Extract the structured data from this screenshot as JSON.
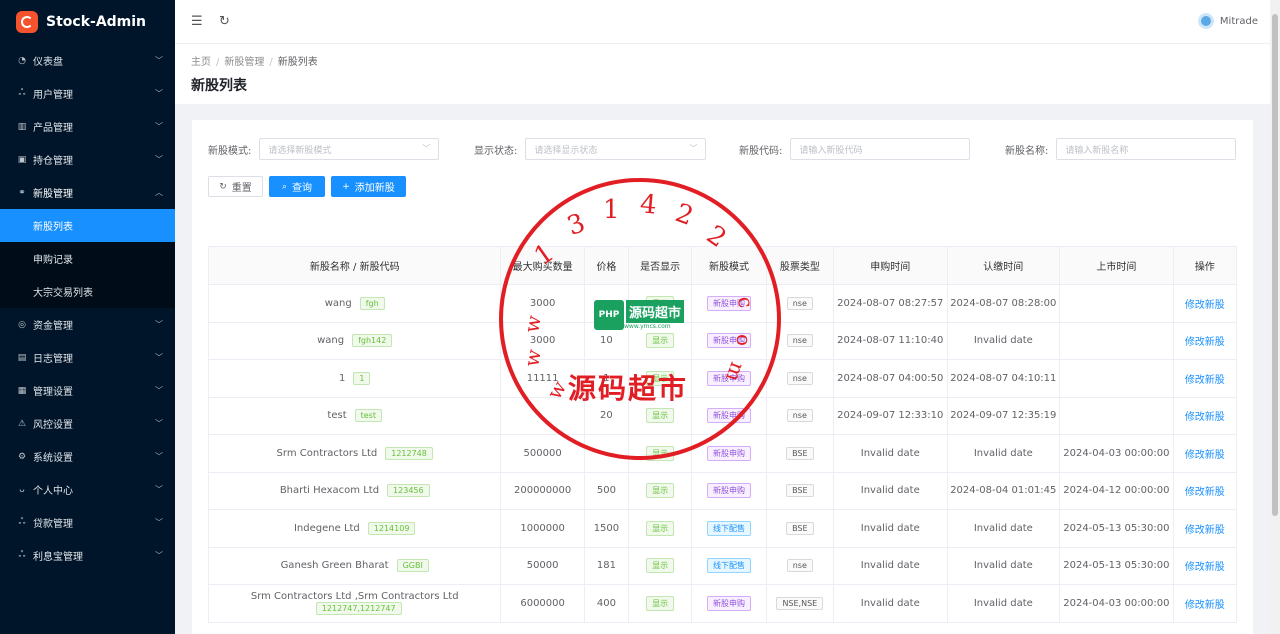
{
  "app": {
    "name": "Stock-Admin"
  },
  "sidebar": {
    "items": [
      {
        "label": "仪表盘",
        "icon": "dashboard-icon",
        "glyph": "◔"
      },
      {
        "label": "用户管理",
        "icon": "users-icon",
        "glyph": "ஃ"
      },
      {
        "label": "产品管理",
        "icon": "chart-icon",
        "glyph": "▥"
      },
      {
        "label": "持仓管理",
        "icon": "wallet-icon",
        "glyph": "▣"
      },
      {
        "label": "新股管理",
        "icon": "ipo-icon",
        "glyph": "⚭"
      },
      {
        "label": "资金管理",
        "icon": "money-icon",
        "glyph": "◎"
      },
      {
        "label": "日志管理",
        "icon": "log-icon",
        "glyph": "▤"
      },
      {
        "label": "管理设置",
        "icon": "admin-icon",
        "glyph": "▦"
      },
      {
        "label": "风控设置",
        "icon": "warning-icon",
        "glyph": "⚠"
      },
      {
        "label": "系统设置",
        "icon": "gear-icon",
        "glyph": "⚙"
      },
      {
        "label": "个人中心",
        "icon": "user-icon",
        "glyph": "ᴗ"
      },
      {
        "label": "贷款管理",
        "icon": "loan-icon",
        "glyph": "ஃ"
      },
      {
        "label": "利息宝管理",
        "icon": "interest-icon",
        "glyph": "ஃ"
      }
    ],
    "submenu": [
      {
        "label": "新股列表",
        "active": true
      },
      {
        "label": "申购记录",
        "active": false
      },
      {
        "label": "大宗交易列表",
        "active": false
      }
    ]
  },
  "header": {
    "username": "Mitrade"
  },
  "breadcrumb": {
    "home": "主页",
    "parent": "新股管理",
    "current": "新股列表"
  },
  "page": {
    "title": "新股列表"
  },
  "filters": {
    "mode_label": "新股模式:",
    "mode_placeholder": "请选择新股模式",
    "status_label": "显示状态:",
    "status_placeholder": "请选择显示状态",
    "code_label": "新股代码:",
    "code_placeholder": "请输入新股代码",
    "name_label": "新股名称:",
    "name_placeholder": "请输入新股名称"
  },
  "buttons": {
    "reset": "重置",
    "search": "查询",
    "add": "添加新股"
  },
  "table": {
    "headers": [
      "新股名称 / 新股代码",
      "最大购买数量",
      "价格",
      "是否显示",
      "新股模式",
      "股票类型",
      "申购时间",
      "认缴时间",
      "上市时间",
      "操作"
    ],
    "rows": [
      {
        "name": "wang",
        "code": "fgh",
        "max": "3000",
        "price": "",
        "show": "显示",
        "mode": "新股申购",
        "mode_color": "purple",
        "type": "nse",
        "apply": "2024-08-07 08:27:57",
        "pay": "2024-08-07 08:28:00",
        "list": "",
        "action": "修改新股"
      },
      {
        "name": "wang",
        "code": "fgh142",
        "max": "3000",
        "price": "10",
        "show": "显示",
        "mode": "新股申购",
        "mode_color": "purple",
        "type": "nse",
        "apply": "2024-08-07 11:10:40",
        "pay": "Invalid date",
        "list": "",
        "action": "修改新股"
      },
      {
        "name": "1",
        "code": "1",
        "max": "11111",
        "price": "1",
        "show": "显示",
        "mode": "新股申购",
        "mode_color": "purple",
        "type": "nse",
        "apply": "2024-08-07 04:00:50",
        "pay": "2024-08-07 04:10:11",
        "list": "",
        "action": "修改新股"
      },
      {
        "name": "test",
        "code": "test",
        "max": "",
        "price": "20",
        "show": "显示",
        "mode": "新股申购",
        "mode_color": "purple",
        "type": "nse",
        "apply": "2024-09-07 12:33:10",
        "pay": "2024-09-07 12:35:19",
        "list": "",
        "action": "修改新股"
      },
      {
        "name": "Srm Contractors Ltd",
        "code": "1212748",
        "max": "500000",
        "price": "",
        "show": "显示",
        "mode": "新股申购",
        "mode_color": "purple",
        "type": "BSE",
        "apply": "Invalid date",
        "pay": "Invalid date",
        "list": "2024-04-03 00:00:00",
        "action": "修改新股"
      },
      {
        "name": "Bharti Hexacom Ltd",
        "code": "123456",
        "max": "200000000",
        "price": "500",
        "show": "显示",
        "mode": "新股申购",
        "mode_color": "purple",
        "type": "BSE",
        "apply": "Invalid date",
        "pay": "2024-08-04 01:01:45",
        "list": "2024-04-12 00:00:00",
        "action": "修改新股"
      },
      {
        "name": "Indegene Ltd",
        "code": "1214109",
        "max": "1000000",
        "price": "1500",
        "show": "显示",
        "mode": "线下配售",
        "mode_color": "blue",
        "type": "BSE",
        "apply": "Invalid date",
        "pay": "Invalid date",
        "list": "2024-05-13 05:30:00",
        "action": "修改新股"
      },
      {
        "name": "Ganesh Green Bharat",
        "code": "GGBI",
        "max": "50000",
        "price": "181",
        "show": "显示",
        "mode": "线下配售",
        "mode_color": "blue",
        "type": "nse",
        "apply": "Invalid date",
        "pay": "Invalid date",
        "list": "2024-05-13 05:30:00",
        "action": "修改新股"
      },
      {
        "name": "Srm Contractors Ltd ,Srm Contractors Ltd",
        "code": "1212747,1212747",
        "max": "6000000",
        "price": "400",
        "show": "显示",
        "mode": "新股申购",
        "mode_color": "purple",
        "type": "NSE,NSE",
        "apply": "Invalid date",
        "pay": "Invalid date",
        "list": "2024-04-03 00:00:00",
        "action": "修改新股"
      }
    ]
  },
  "watermark": {
    "arc_text": [
      "1",
      "3",
      "1",
      "4",
      "2",
      "2"
    ],
    "side_left": [
      "w",
      "w",
      "w"
    ],
    "side_right": [
      "c",
      "o",
      "m"
    ],
    "center": "源码超市",
    "logo_php": "PHP",
    "logo_name": "源码超市",
    "logo_url": "www.ymcs.com",
    "color": "#e21e25"
  },
  "colors": {
    "primary": "#1890ff",
    "sidebar_bg": "#001529"
  }
}
